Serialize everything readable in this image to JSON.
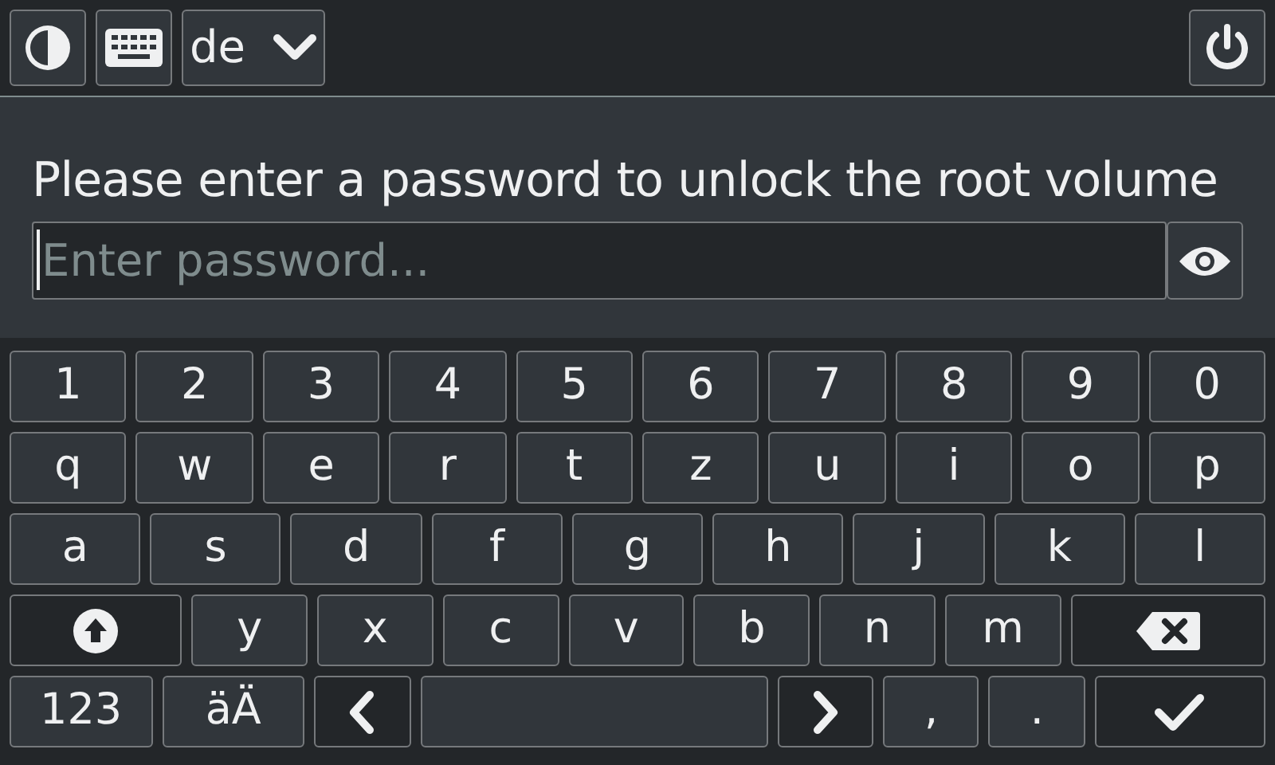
{
  "top_bar": {
    "layout_button": {
      "label": "de"
    }
  },
  "prompt": {
    "message": "Please enter a password to unlock the root volume",
    "password_field": {
      "placeholder": "Enter password..."
    }
  },
  "keyboard": {
    "rows": [
      {
        "keys": [
          {
            "kind": "char",
            "label": "1"
          },
          {
            "kind": "char",
            "label": "2"
          },
          {
            "kind": "char",
            "label": "3"
          },
          {
            "kind": "char",
            "label": "4"
          },
          {
            "kind": "char",
            "label": "5"
          },
          {
            "kind": "char",
            "label": "6"
          },
          {
            "kind": "char",
            "label": "7"
          },
          {
            "kind": "char",
            "label": "8"
          },
          {
            "kind": "char",
            "label": "9"
          },
          {
            "kind": "char",
            "label": "0"
          }
        ]
      },
      {
        "keys": [
          {
            "kind": "char",
            "label": "q"
          },
          {
            "kind": "char",
            "label": "w"
          },
          {
            "kind": "char",
            "label": "e"
          },
          {
            "kind": "char",
            "label": "r"
          },
          {
            "kind": "char",
            "label": "t"
          },
          {
            "kind": "char",
            "label": "z"
          },
          {
            "kind": "char",
            "label": "u"
          },
          {
            "kind": "char",
            "label": "i"
          },
          {
            "kind": "char",
            "label": "o"
          },
          {
            "kind": "char",
            "label": "p"
          }
        ]
      },
      {
        "keys": [
          {
            "kind": "char",
            "label": "a"
          },
          {
            "kind": "char",
            "label": "s"
          },
          {
            "kind": "char",
            "label": "d"
          },
          {
            "kind": "char",
            "label": "f"
          },
          {
            "kind": "char",
            "label": "g"
          },
          {
            "kind": "char",
            "label": "h"
          },
          {
            "kind": "char",
            "label": "j"
          },
          {
            "kind": "char",
            "label": "k"
          },
          {
            "kind": "char",
            "label": "l"
          }
        ]
      },
      {
        "keys": [
          {
            "kind": "shift"
          },
          {
            "kind": "char",
            "label": "y"
          },
          {
            "kind": "char",
            "label": "x"
          },
          {
            "kind": "char",
            "label": "c"
          },
          {
            "kind": "char",
            "label": "v"
          },
          {
            "kind": "char",
            "label": "b"
          },
          {
            "kind": "char",
            "label": "n"
          },
          {
            "kind": "char",
            "label": "m"
          },
          {
            "kind": "backspace"
          }
        ]
      },
      {
        "keys": [
          {
            "kind": "mode",
            "label": "123"
          },
          {
            "kind": "mode",
            "label": "äÄ"
          },
          {
            "kind": "left"
          },
          {
            "kind": "space"
          },
          {
            "kind": "right"
          },
          {
            "kind": "char",
            "label": ","
          },
          {
            "kind": "char",
            "label": "."
          },
          {
            "kind": "enter"
          }
        ]
      }
    ]
  }
}
